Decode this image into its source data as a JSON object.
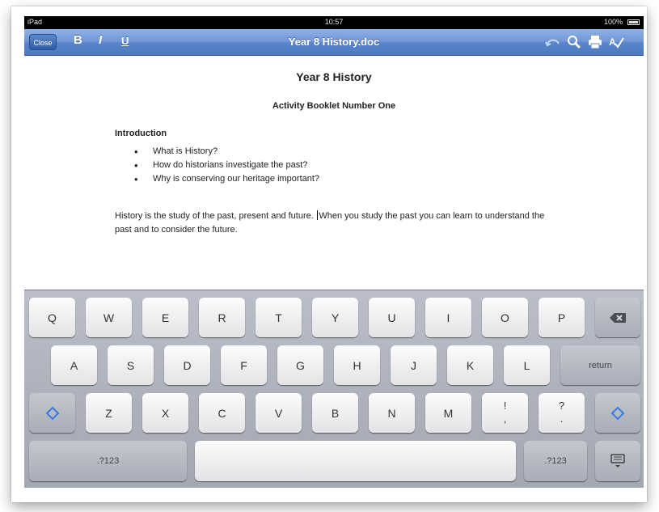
{
  "status_bar": {
    "carrier": "iPad",
    "time": "10:57",
    "battery": "100%"
  },
  "toolbar": {
    "close_label": "Close",
    "bold_label": "B",
    "italic_label": "I",
    "underline_label": "U",
    "title": "Year 8 History.doc",
    "icons": [
      "undo-icon",
      "search-icon",
      "print-icon",
      "spell-check-icon"
    ]
  },
  "document": {
    "heading": "Year 8 History",
    "subheading": "Activity Booklet Number One",
    "section_heading": "Introduction",
    "bullets": [
      "What is History?",
      "How do historians investigate the past?",
      "Why is conserving our heritage important?"
    ],
    "paragraph_before_cursor": "History is the study of the past, present and future. ",
    "paragraph_after_cursor": "When you study the past you can learn to understand the past and to consider the future."
  },
  "keyboard": {
    "row1": [
      "Q",
      "W",
      "E",
      "R",
      "T",
      "Y",
      "U",
      "I",
      "O",
      "P"
    ],
    "row2": [
      "A",
      "S",
      "D",
      "F",
      "G",
      "H",
      "J",
      "K",
      "L"
    ],
    "return_label": "return",
    "row3": [
      "Z",
      "X",
      "C",
      "V",
      "B",
      "N",
      "M"
    ],
    "punct1": [
      "!",
      ","
    ],
    "punct2": [
      "?",
      "."
    ],
    "numbers_label": ".?123",
    "icons": [
      "backspace-icon",
      "shift-icon",
      "hide-keyboard-icon"
    ]
  }
}
